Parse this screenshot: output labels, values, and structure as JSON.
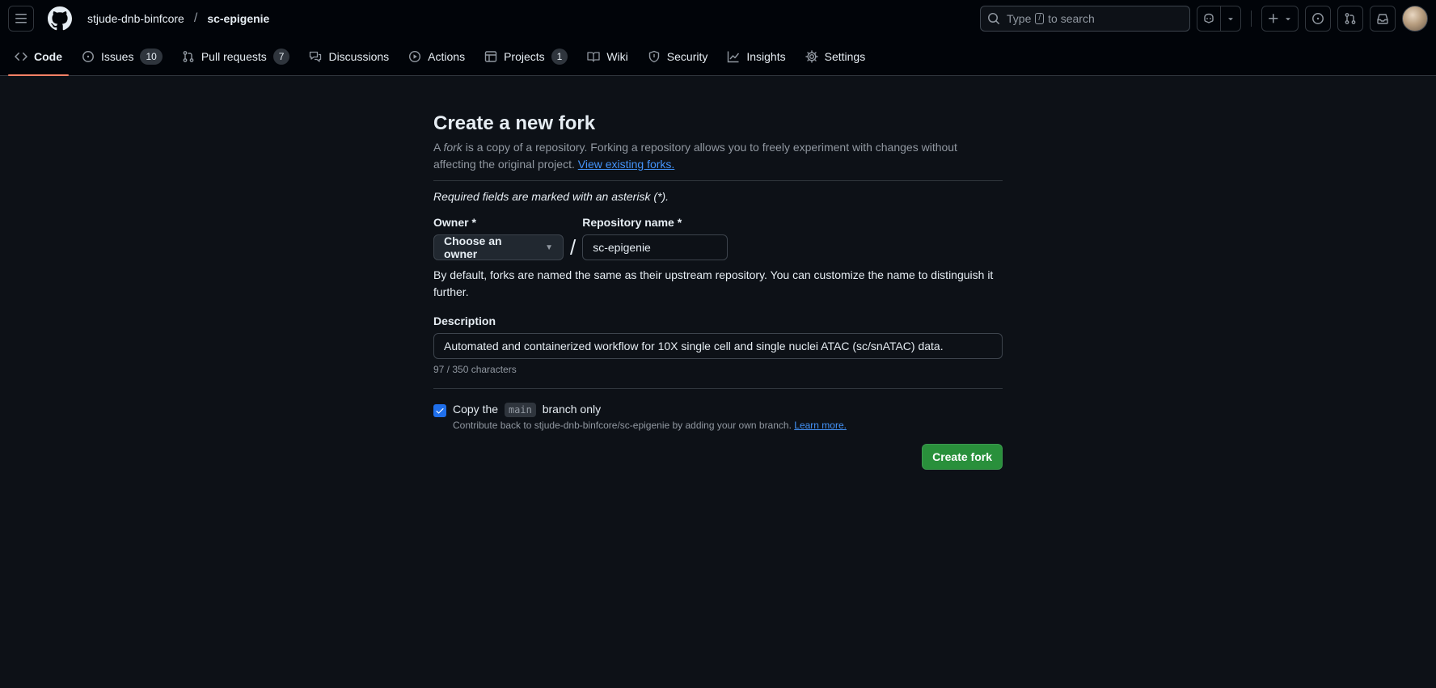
{
  "header": {
    "owner": "stjude-dnb-binfcore",
    "separator": "/",
    "repo": "sc-epigenie",
    "search": {
      "prefix": "Type",
      "key": "/",
      "suffix": "to search"
    }
  },
  "tabs": [
    {
      "label": "Code",
      "icon": "code-icon",
      "selected": true
    },
    {
      "label": "Issues",
      "icon": "issue-icon",
      "count": "10"
    },
    {
      "label": "Pull requests",
      "icon": "pull-request-icon",
      "count": "7"
    },
    {
      "label": "Discussions",
      "icon": "discussion-icon"
    },
    {
      "label": "Actions",
      "icon": "play-icon"
    },
    {
      "label": "Projects",
      "icon": "table-icon",
      "count": "1"
    },
    {
      "label": "Wiki",
      "icon": "book-icon"
    },
    {
      "label": "Security",
      "icon": "shield-icon"
    },
    {
      "label": "Insights",
      "icon": "graph-icon"
    },
    {
      "label": "Settings",
      "icon": "gear-icon"
    }
  ],
  "form": {
    "title": "Create a new fork",
    "intro_a": "A",
    "intro_fork": "fork",
    "intro_rest": "is a copy of a repository. Forking a repository allows you to freely experiment with changes without affecting the original project.",
    "intro_link": "View existing forks.",
    "required_note": "Required fields are marked with an asterisk (*).",
    "owner_label": "Owner *",
    "owner_button": "Choose an owner",
    "slash": "/",
    "repo_label": "Repository name *",
    "repo_value": "sc-epigenie",
    "name_hint": "By default, forks are named the same as their upstream repository. You can customize the name to distinguish it further.",
    "description_label": "Description",
    "description_value": "Automated and containerized workflow for 10X single cell and single nuclei ATAC (sc/snATAC) data.",
    "char_count": "97 / 350 characters",
    "copy_prefix": "Copy the",
    "copy_branch": "main",
    "copy_suffix": "branch only",
    "copy_checked": true,
    "copy_sub": "Contribute back to stjude-dnb-binfcore/sc-epigenie by adding your own branch.",
    "learn_more": "Learn more.",
    "submit": "Create fork"
  },
  "colors": {
    "background": "#0d1117",
    "header": "#010409",
    "accent_link": "#4493f8",
    "primary_button": "#29903b",
    "tab_underline": "#f78166",
    "checkbox": "#1f6feb"
  }
}
